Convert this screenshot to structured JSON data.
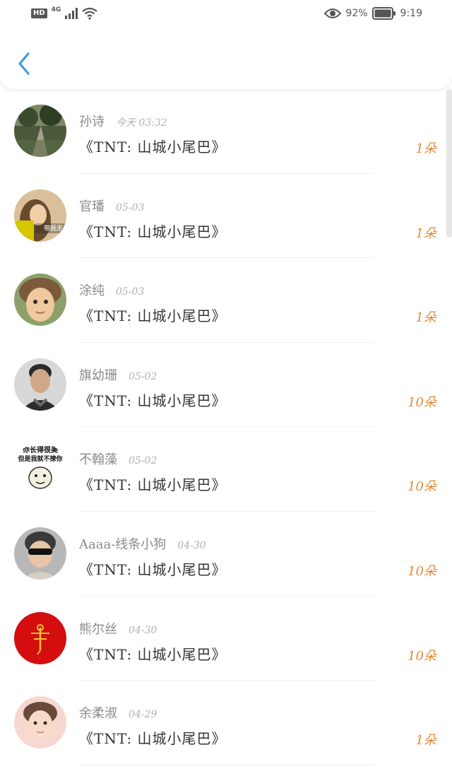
{
  "status_bar": {
    "hd": "HD",
    "network": "4G",
    "battery": "92%",
    "time": "9:19"
  },
  "header": {
    "back_icon": "chevron-left-icon"
  },
  "items": [
    {
      "name": "孙诗",
      "date": "今天 03:32",
      "title": "《TNT: 山城小尾巴》",
      "count": "1朵"
    },
    {
      "name": "官璠",
      "date": "05-03",
      "title": "《TNT: 山城小尾巴》",
      "count": "1朵"
    },
    {
      "name": "涂纯",
      "date": "05-03",
      "title": "《TNT: 山城小尾巴》",
      "count": "1朵"
    },
    {
      "name": "旗幼珊",
      "date": "05-02",
      "title": "《TNT: 山城小尾巴》",
      "count": "10朵"
    },
    {
      "name": "不翰藻",
      "date": "05-02",
      "title": "《TNT: 山城小尾巴》",
      "count": "10朵"
    },
    {
      "name": "Aaaa-线条小狗",
      "date": "04-30",
      "title": "《TNT: 山城小尾巴》",
      "count": "10朵"
    },
    {
      "name": "熊尔丝",
      "date": "04-30",
      "title": "《TNT: 山城小尾巴》",
      "count": "10朵"
    },
    {
      "name": "余柔淑",
      "date": "04-29",
      "title": "《TNT: 山城小尾巴》",
      "count": "1朵"
    }
  ],
  "avatar_texts": {
    "a2": "带我走",
    "a5_line1": "你长得很美",
    "a5_line2": "但是我就不撩你"
  },
  "colors": {
    "accent_blue": "#3a9de0",
    "count_orange": "#e08a3c"
  }
}
